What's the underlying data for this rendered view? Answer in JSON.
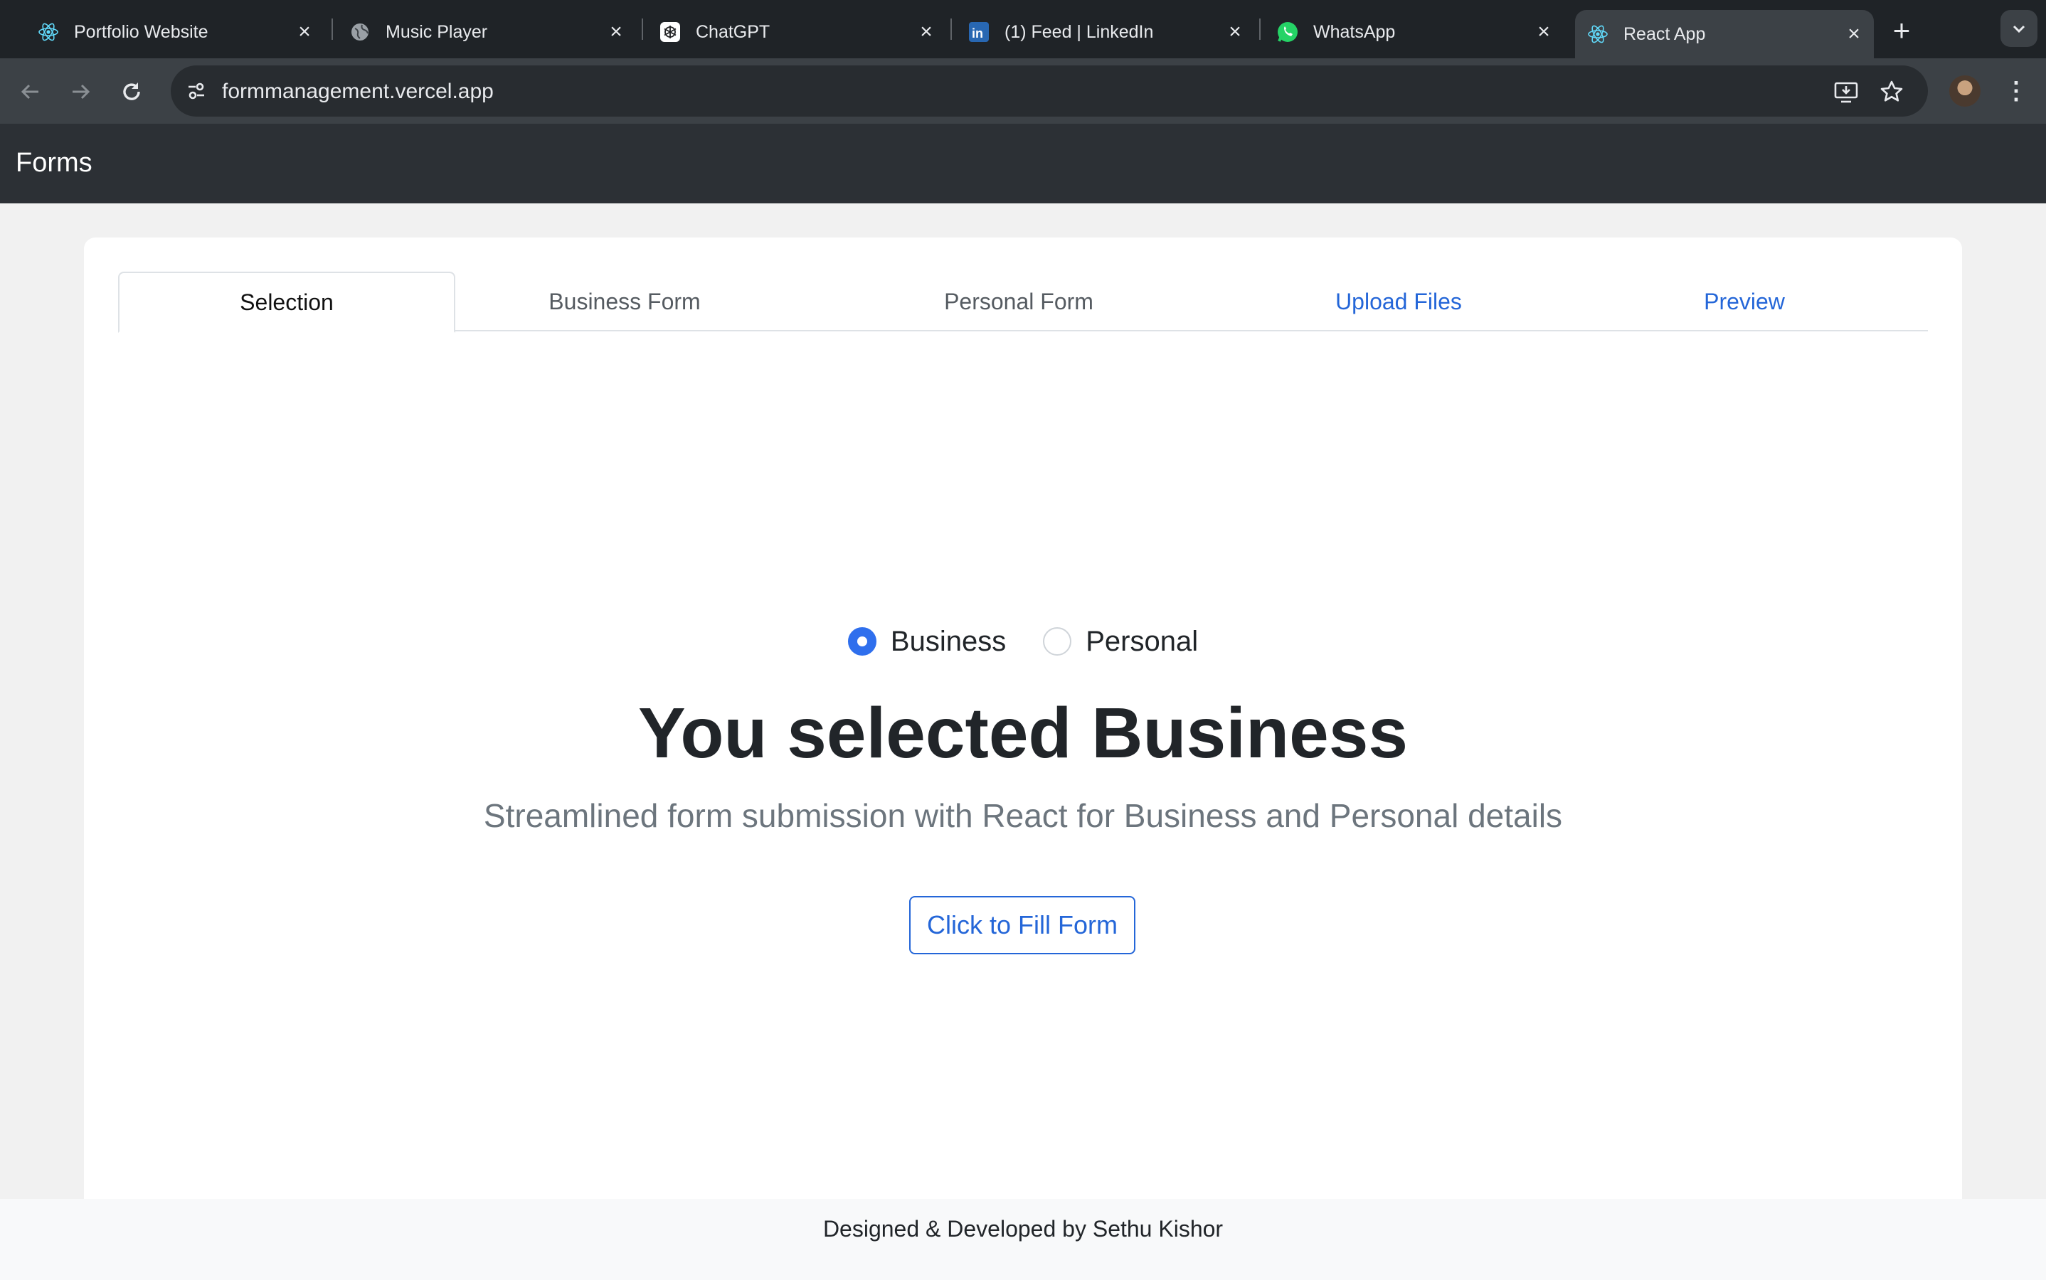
{
  "browser": {
    "tabs": [
      {
        "title": "Portfolio Website",
        "icon": "react-icon"
      },
      {
        "title": "Music Player",
        "icon": "globe-icon"
      },
      {
        "title": "ChatGPT",
        "icon": "chatgpt-icon"
      },
      {
        "title": "(1) Feed | LinkedIn",
        "icon": "linkedin-icon"
      },
      {
        "title": "WhatsApp",
        "icon": "whatsapp-icon"
      },
      {
        "title": "React App",
        "icon": "react-icon",
        "active": true
      }
    ],
    "url": "formmanagement.vercel.app"
  },
  "app": {
    "brand": "Forms",
    "tabs": [
      {
        "label": "Selection",
        "state": "active"
      },
      {
        "label": "Business Form",
        "state": "normal"
      },
      {
        "label": "Personal Form",
        "state": "normal"
      },
      {
        "label": "Upload Files",
        "state": "link"
      },
      {
        "label": "Preview",
        "state": "link"
      }
    ],
    "radios": [
      {
        "label": "Business",
        "checked": true
      },
      {
        "label": "Personal",
        "checked": false
      }
    ],
    "heading": "You selected Business",
    "lead": "Streamlined form submission with React for Business and Personal details",
    "cta_label": "Click to Fill Form"
  },
  "footer": {
    "text": "Designed & Developed by Sethu Kishor"
  },
  "colors": {
    "accent": "#2466d8",
    "radio_checked": "#2f6fed",
    "navbar": "#2c3035"
  }
}
